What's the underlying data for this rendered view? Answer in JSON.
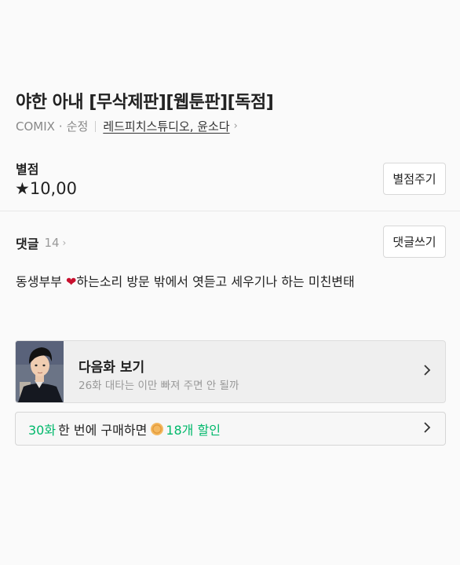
{
  "title": "야한 아내 [무삭제판][웹툰판][독점]",
  "meta": {
    "publisher": "COMIX",
    "separator": "·",
    "genre": "순정",
    "authors": "레드피치스튜디오, 윤소다"
  },
  "rating": {
    "label": "별점",
    "star": "★",
    "value": "10,00",
    "button_label": "별점주기"
  },
  "comments": {
    "label": "댓글",
    "count": "14",
    "button_label": "댓글쓰기",
    "top_comment_before": "동생부부 ",
    "top_comment_emoji": "❤",
    "top_comment_after": "하는소리 방문 밖에서 엿듣고 세우기나 하는 미친변태"
  },
  "next_episode": {
    "title": "다음화 보기",
    "subtitle": "26화 대타는 이만 빠져 주면 안 될까",
    "icon": "chevron-right-icon"
  },
  "promo": {
    "episode_count": "30화",
    "text": "한 번에 구매하면",
    "discount": "18개 할인",
    "icon": "coin-icon",
    "accent_color": "#00b86b"
  }
}
